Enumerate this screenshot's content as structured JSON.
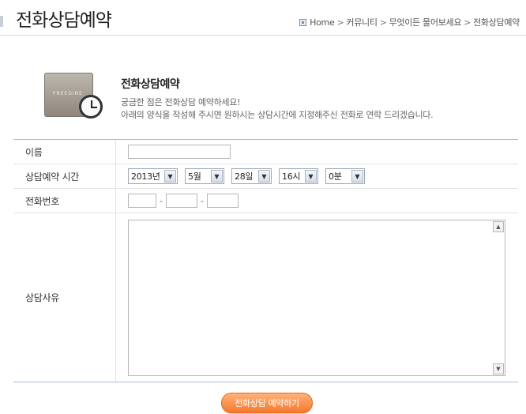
{
  "page": {
    "title": "전화상담예약"
  },
  "breadcrumb": {
    "items": [
      "Home",
      "커뮤니티",
      "무엇이든 물어보세요",
      "전화상담예약"
    ],
    "separator": ">"
  },
  "intro": {
    "heading": "전화상담예약",
    "line1": "궁금한 점은 전화상담 예약하세요!",
    "line2": "아래의 양식을 작성해 주시면 원하시는 상담시간에 지정해주신 전화로 연락 드리겠습니다.",
    "laptop_text": "FREEGINE"
  },
  "form": {
    "name_label": "이름",
    "name_value": "",
    "time_label": "상담예약 시간",
    "time_selects": {
      "year": "2013년",
      "month": "5월",
      "day": "28일",
      "hour": "16시",
      "minute": "0분"
    },
    "phone_label": "전화번호",
    "phone_separator": "-",
    "phone_parts": [
      "",
      "",
      ""
    ],
    "reason_label": "상담사유",
    "reason_value": ""
  },
  "actions": {
    "submit_label": "전화상담 예약하기"
  },
  "icons": {
    "home": "home-icon",
    "dropdown": "chevron-down-icon",
    "scroll_up": "scroll-up-arrow-icon",
    "scroll_down": "scroll-down-arrow-icon",
    "illustration": "laptop-clock-illustration"
  },
  "colors": {
    "accent": "#f47a2d",
    "border": "#a9bccf"
  }
}
